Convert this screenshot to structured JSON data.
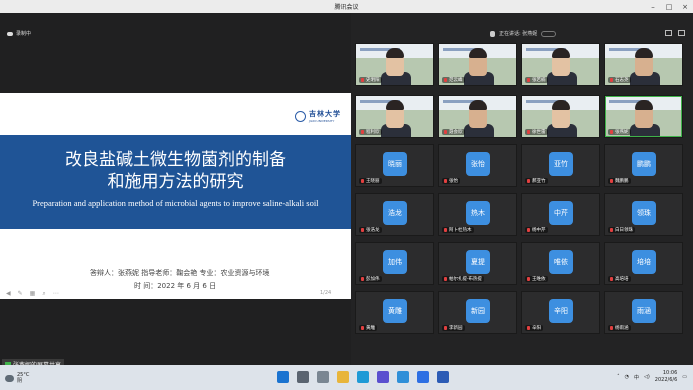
{
  "window": {
    "title": "腾讯会议"
  },
  "recording": {
    "label": "录制中"
  },
  "speaking": {
    "label": "正在讲话: 张燕妮"
  },
  "slide": {
    "university_cn": "吉林大学",
    "university_en": "JILIN UNIVERSITY",
    "title_line1": "改良盐碱土微生物菌剂的制备",
    "title_line2": "和施用方法的研究",
    "title_en": "Preparation and application method of microbial agents to improve saline-alkali soil",
    "info_line1": "答辩人：张燕妮  指导老师：鞠会艳  专业：农业资源与环境",
    "info_line2": "时    间：2022 年 6 月 6 日",
    "page_indicator": "1/24"
  },
  "share": {
    "label": "张燕妮的屏幕共享"
  },
  "participants": [
    {
      "name": "史明阳",
      "kind": "video"
    },
    {
      "name": "范云峰",
      "kind": "video"
    },
    {
      "name": "张若楠",
      "kind": "video"
    },
    {
      "name": "石志尧",
      "kind": "video"
    },
    {
      "name": "程利欣",
      "kind": "video"
    },
    {
      "name": "聂会欣",
      "kind": "video"
    },
    {
      "name": "徐世雷",
      "kind": "video"
    },
    {
      "name": "张燕妮",
      "kind": "video"
    },
    {
      "name": "王晓丽",
      "avatar": "晓丽",
      "kind": "avatar"
    },
    {
      "name": "张怡",
      "avatar": "张怡",
      "kind": "avatar"
    },
    {
      "name": "郝亚竹",
      "avatar": "亚竹",
      "kind": "avatar"
    },
    {
      "name": "魏鹏鹏",
      "avatar": "鹏鹏",
      "kind": "avatar"
    },
    {
      "name": "张浩龙",
      "avatar": "浩龙",
      "kind": "avatar"
    },
    {
      "name": "阿卜杜热木",
      "avatar": "热木",
      "kind": "avatar"
    },
    {
      "name": "杨中芹",
      "avatar": "中芹",
      "kind": "avatar"
    },
    {
      "name": "白日领珠",
      "avatar": "领珠",
      "kind": "avatar"
    },
    {
      "name": "彭加伟",
      "avatar": "加伟",
      "kind": "avatar"
    },
    {
      "name": "帕尔扎提·布热提",
      "avatar": "夏提",
      "kind": "avatar"
    },
    {
      "name": "王唯依",
      "avatar": "唯依",
      "kind": "avatar"
    },
    {
      "name": "高培培",
      "avatar": "培培",
      "kind": "avatar"
    },
    {
      "name": "黄雕",
      "avatar": "黄雕",
      "kind": "avatar"
    },
    {
      "name": "李新园",
      "avatar": "新园",
      "kind": "avatar"
    },
    {
      "name": "辛阳",
      "avatar": "辛阳",
      "kind": "avatar"
    },
    {
      "name": "杨雨涵",
      "avatar": "雨涵",
      "kind": "avatar"
    }
  ],
  "taskbar": {
    "temperature": "25°C",
    "weather": "阴",
    "tray_ime": "中",
    "time": "10:06",
    "date": "2022/6/6"
  },
  "colors": {
    "slide_band": "#1f5496",
    "avatar": "#3d8fe0",
    "mute": "#e24040"
  }
}
